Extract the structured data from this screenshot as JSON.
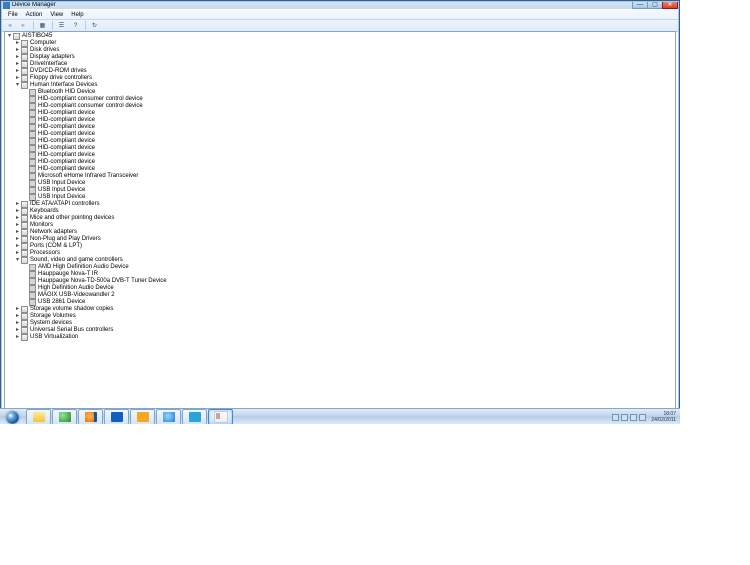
{
  "window": {
    "title": "Device Manager",
    "buttons": {
      "min": "—",
      "max": "▢",
      "close": "✕"
    }
  },
  "menubar": [
    "File",
    "Action",
    "View",
    "Help"
  ],
  "toolbar_tips": [
    "Back",
    "Forward",
    "Show hidden devices",
    "Properties",
    "Help",
    "Scan for hardware changes"
  ],
  "root": "AISTIBO45",
  "nodes": [
    {
      "label": "Computer",
      "icon": "computer-icon",
      "expanded": false,
      "children": []
    },
    {
      "label": "Disk drives",
      "icon": "disk-icon",
      "expanded": false,
      "children": []
    },
    {
      "label": "Display adapters",
      "icon": "display-icon",
      "expanded": false,
      "children": []
    },
    {
      "label": "DriveInterface",
      "icon": "drive-if-icon",
      "expanded": false,
      "children": []
    },
    {
      "label": "DVD/CD-ROM drives",
      "icon": "optical-icon",
      "expanded": false,
      "children": []
    },
    {
      "label": "Floppy drive controllers",
      "icon": "floppy-icon",
      "expanded": false,
      "children": []
    },
    {
      "label": "Human Interface Devices",
      "icon": "hid-icon",
      "expanded": true,
      "children": [
        {
          "label": "Bluetooth HID Device",
          "icon": "hid-dev-icon"
        },
        {
          "label": "HID-compliant consumer control device",
          "icon": "hid-dev-icon"
        },
        {
          "label": "HID-compliant consumer control device",
          "icon": "hid-dev-icon"
        },
        {
          "label": "HID-compliant device",
          "icon": "hid-dev-icon"
        },
        {
          "label": "HID-compliant device",
          "icon": "hid-dev-icon"
        },
        {
          "label": "HID-compliant device",
          "icon": "hid-dev-icon"
        },
        {
          "label": "HID-compliant device",
          "icon": "hid-dev-icon"
        },
        {
          "label": "HID-compliant device",
          "icon": "hid-dev-icon"
        },
        {
          "label": "HID-compliant device",
          "icon": "hid-dev-icon"
        },
        {
          "label": "HID-compliant device",
          "icon": "hid-dev-icon"
        },
        {
          "label": "HID-compliant device",
          "icon": "hid-dev-icon"
        },
        {
          "label": "HID-compliant device",
          "icon": "hid-dev-icon"
        },
        {
          "label": "Microsoft eHome Infrared Transceiver",
          "icon": "hid-dev-icon"
        },
        {
          "label": "USB Input Device",
          "icon": "hid-dev-icon"
        },
        {
          "label": "USB Input Device",
          "icon": "hid-dev-icon"
        },
        {
          "label": "USB Input Device",
          "icon": "hid-dev-icon"
        }
      ]
    },
    {
      "label": "IDE ATA/ATAPI controllers",
      "icon": "ide-icon",
      "expanded": false,
      "children": []
    },
    {
      "label": "Keyboards",
      "icon": "keyboard-icon",
      "expanded": false,
      "children": []
    },
    {
      "label": "Mice and other pointing devices",
      "icon": "mouse-icon",
      "expanded": false,
      "children": []
    },
    {
      "label": "Monitors",
      "icon": "monitor-icon",
      "expanded": false,
      "children": []
    },
    {
      "label": "Network adapters",
      "icon": "network-icon",
      "expanded": false,
      "children": []
    },
    {
      "label": "Non-Plug and Play Drivers",
      "icon": "npnp-icon",
      "expanded": false,
      "children": []
    },
    {
      "label": "Ports (COM & LPT)",
      "icon": "ports-icon",
      "expanded": false,
      "children": []
    },
    {
      "label": "Processors",
      "icon": "cpu-icon",
      "expanded": false,
      "children": []
    },
    {
      "label": "Sound, video and game controllers",
      "icon": "sound-icon",
      "expanded": true,
      "children": [
        {
          "label": "AMD High Definition Audio Device",
          "icon": "sound-dev-icon"
        },
        {
          "label": "Hauppauge Nova-T IR",
          "icon": "sound-dev-icon"
        },
        {
          "label": "Hauppauge Nova-TD-500a DVB-T Tuner Device",
          "icon": "sound-dev-icon"
        },
        {
          "label": "High Definition Audio Device",
          "icon": "sound-dev-icon"
        },
        {
          "label": "MAGIX USB-Videowandler 2",
          "icon": "sound-dev-icon"
        },
        {
          "label": "USB 2861 Device",
          "icon": "sound-dev-icon"
        }
      ]
    },
    {
      "label": "Storage volume shadow copies",
      "icon": "shadow-icon",
      "expanded": false,
      "children": []
    },
    {
      "label": "Storage Volumes",
      "icon": "volume-icon",
      "expanded": false,
      "children": []
    },
    {
      "label": "System devices",
      "icon": "system-icon",
      "expanded": false,
      "children": []
    },
    {
      "label": "Universal Serial Bus controllers",
      "icon": "usb-icon",
      "expanded": false,
      "children": []
    },
    {
      "label": "USB Virtualization",
      "icon": "usb-virt-icon",
      "expanded": false,
      "children": []
    }
  ],
  "taskbar": {
    "pins": [
      {
        "name": "explorer",
        "label": "Windows Explorer",
        "cls": "c-ex"
      },
      {
        "name": "browser-globe",
        "label": "Browser",
        "cls": "c-gl"
      },
      {
        "name": "firefox",
        "label": "Mozilla Firefox",
        "cls": "c-ff"
      },
      {
        "name": "bluetooth",
        "label": "Bluetooth",
        "cls": "c-bt"
      },
      {
        "name": "outlook",
        "label": "Microsoft Outlook",
        "cls": "c-ol"
      },
      {
        "name": "internet-explorer",
        "label": "Internet Explorer",
        "cls": "c-ie"
      },
      {
        "name": "media-player",
        "label": "Windows Media Player",
        "cls": "c-wm"
      },
      {
        "name": "snipping-tool",
        "label": "Snipping Tool",
        "cls": "c-sn",
        "active": true
      }
    ],
    "tray_icons": [
      "show-hidden-icons-icon",
      "action-center-icon",
      "network-tray-icon",
      "volume-tray-icon"
    ],
    "clock": {
      "time": "18:07",
      "date": "24/02/2011"
    }
  }
}
